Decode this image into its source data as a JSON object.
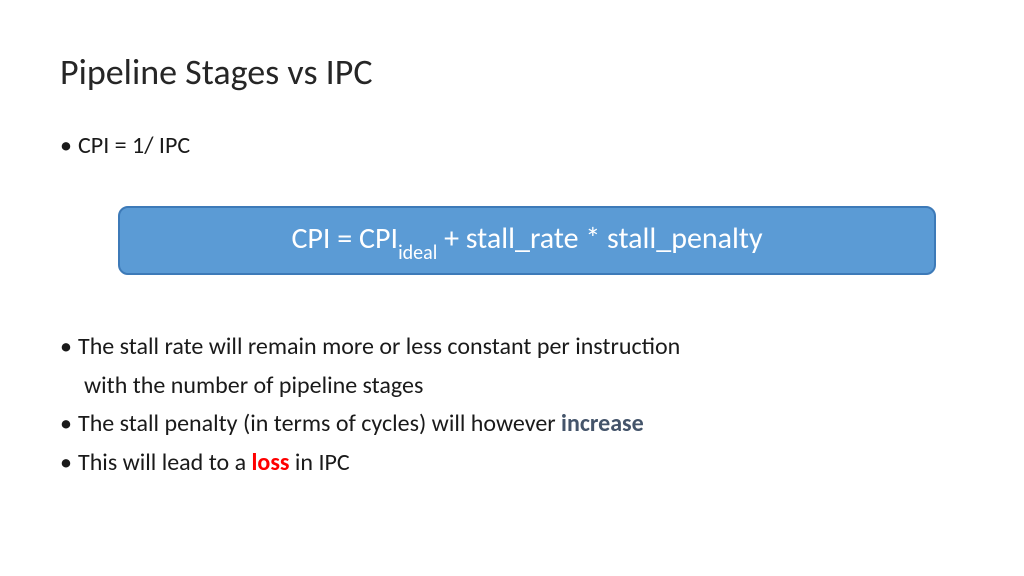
{
  "title": "Pipeline Stages vs IPC",
  "bullets": {
    "b1": "CPI = 1/ IPC",
    "formula_pre": "CPI = CPI",
    "formula_sub": "ideal",
    "formula_post": " + stall_rate * stall_penalty",
    "b2_line1": "The stall rate will remain more or less constant per instruction",
    "b2_line2": "with the number of pipeline stages",
    "b3_pre": "The stall penalty (in terms of cycles) will however ",
    "b3_emph": "increase",
    "b4_pre": "This will lead to a ",
    "b4_emph": "loss",
    "b4_post": " in IPC"
  }
}
